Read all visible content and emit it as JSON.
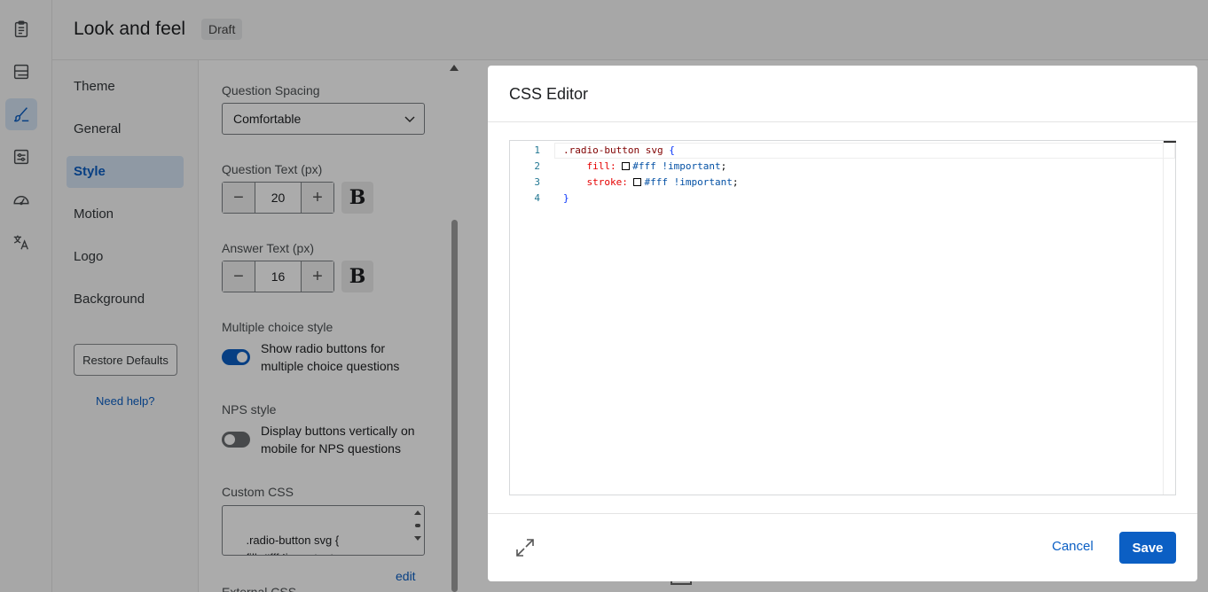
{
  "header": {
    "title": "Look and feel",
    "badge": "Draft"
  },
  "rail": {
    "icons": [
      "clipboard-icon",
      "layout-icon",
      "brush-icon",
      "sliders-icon",
      "gauge-icon",
      "translate-icon"
    ],
    "active": "brush-icon"
  },
  "subnav": {
    "items": [
      {
        "label": "Theme"
      },
      {
        "label": "General"
      },
      {
        "label": "Style"
      },
      {
        "label": "Motion"
      },
      {
        "label": "Logo"
      },
      {
        "label": "Background"
      }
    ],
    "active": "Style",
    "restore_label": "Restore Defaults",
    "help_label": "Need help?"
  },
  "panel": {
    "spacing_label": "Question Spacing",
    "spacing_value": "Comfortable",
    "question_text_label": "Question Text (px)",
    "question_text_value": "20",
    "answer_text_label": "Answer Text (px)",
    "answer_text_value": "16",
    "bold_glyph": "B",
    "mc_style_label": "Multiple choice style",
    "mc_toggle_text": "Show radio buttons for multiple choice questions",
    "mc_toggle_on": true,
    "nps_label": "NPS style",
    "nps_toggle_text": "Display buttons vertically on mobile for NPS questions",
    "nps_toggle_on": false,
    "custom_css_label": "Custom CSS",
    "custom_css_preview": ".radio-button svg {\n    fill: #fff !important;\n    stroke: #fff !important;",
    "edit_label": "edit",
    "external_css_label": "External CSS"
  },
  "modal": {
    "title": "CSS Editor",
    "lines": [
      {
        "n": "1",
        "selector": ".radio-button svg",
        "brace": " {"
      },
      {
        "n": "2",
        "prop": "fill:",
        "value": "#fff !important",
        "end": ";"
      },
      {
        "n": "3",
        "prop": "stroke:",
        "value": "#fff !important",
        "end": ";"
      },
      {
        "n": "4",
        "brace": "}"
      }
    ],
    "cancel_label": "Cancel",
    "save_label": "Save"
  },
  "colors": {
    "accent": "#0b5fc4",
    "active_bg": "#d6e4f5"
  }
}
